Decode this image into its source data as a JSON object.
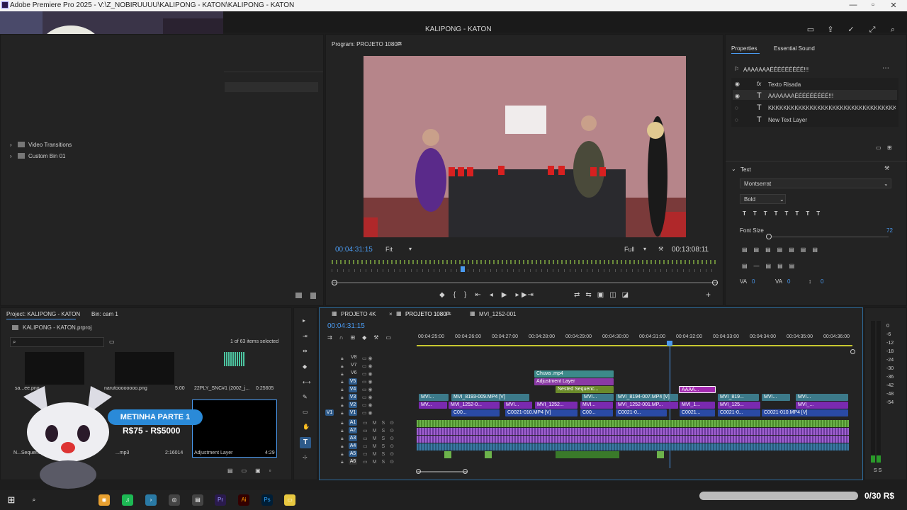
{
  "window": {
    "title": "Adobe Premiere Pro 2025 - V:\\Z_NOBIRUUUU\\KALIPONG - KATON\\KALIPONG - KATON",
    "project_name": "KALIPONG - KATON"
  },
  "project_tree": {
    "items": [
      "Video Transitions",
      "Custom Bin 01"
    ]
  },
  "program_monitor": {
    "title": "Program: PROJETO 1080P",
    "timecode": "00:04:31:15",
    "fit": "Fit",
    "quality": "Full",
    "duration": "00:13:08:11"
  },
  "properties": {
    "tabs": [
      "Properties",
      "Essential Sound"
    ],
    "selected_layer": "AAAAAAAÉÉÉÉÉÉÉÉÉ!!!",
    "layers": [
      {
        "name": "Texto Risada",
        "icon": "fx-icon"
      },
      {
        "name": "AAAAAAAÉÉÉÉÉÉÉÉÉ!!!",
        "icon": "text-icon"
      },
      {
        "name": "KKKKKKKKKKKKKKKKKKKKKKKKKKKKKKKKKKKKKKKKK...",
        "icon": "text-icon"
      },
      {
        "name": "New Text Layer",
        "icon": "text-icon"
      }
    ],
    "text_section": "Text",
    "font": "Montserrat",
    "weight": "Bold",
    "font_size_label": "Font Size",
    "font_size": "72",
    "val_a": "0",
    "val_b": "0",
    "val_c": "0"
  },
  "project_panel": {
    "title": "Project: KALIPONG - KATON",
    "bin_tab": "Bin: cam 1",
    "file": "KALIPONG - KATON.prproj",
    "selection": "1 of 63 items selected",
    "items": [
      {
        "name": "sa...ee.png",
        "dur": ""
      },
      {
        "name": "narutoooooooo.png",
        "dur": "5:00"
      },
      {
        "name": "22PLY_SNC#1 (2002_j...",
        "dur": "0:25605"
      },
      {
        "name": "N...Sequence",
        "dur": ""
      },
      {
        "name": "...mp3",
        "dur": "2:16014"
      },
      {
        "name": "Adjustment Layer",
        "dur": "4:29"
      }
    ]
  },
  "overlay": {
    "badge": "METINHA PARTE 1",
    "price": "R$75 - R$5000",
    "goal": "0/30 R$"
  },
  "timeline": {
    "tabs": [
      "PROJETO 4K",
      "PROJETO 1080P",
      "MVI_1252-001"
    ],
    "timecode": "00:04:31:15",
    "ruler": [
      "00:04:25:00",
      "00:04:26:00",
      "00:04:27:00",
      "00:04:28:00",
      "00:04:29:00",
      "00:04:30:00",
      "00:04:31:00",
      "00:04:32:00",
      "00:04:33:00",
      "00:04:34:00",
      "00:04:35:00",
      "00:04:36:00"
    ],
    "video_tracks": [
      "V8",
      "V7",
      "V6",
      "V5",
      "V4",
      "V3",
      "V2",
      "V1"
    ],
    "audio_tracks": [
      "A1",
      "A2",
      "A3",
      "A4",
      "A5",
      "A6"
    ],
    "clips": {
      "chuva": "Chuva .mp4",
      "adj": "Adjustment Layer",
      "nested": "Nested Sequenc...",
      "aaaa": "AAAA...",
      "v3a": "MVI...",
      "v3b": "MVI_8193-009.MP4 [V]",
      "v3c": "MVI...",
      "v3d": "MVI_8194-007.MP4 [V]",
      "v3e": "MVI_819...",
      "v3f": "MVI...",
      "v3g": "MVI...",
      "v2a": "MV...",
      "v2b": "MVI_1252-0...",
      "v2c": "MVI...",
      "v2d": "MVI_1252...",
      "v2e": "MVI...",
      "v2f": "MVI_1252-001.MP...",
      "v2g": "MVI_1...",
      "v2h": "MVI_125...",
      "v2i": "MVI_...",
      "v1a": "C00...",
      "v1b": "C0021-010.MP4 [V]",
      "v1c": "C00...",
      "v1d": "C0021-0...",
      "v1e": "C0021...",
      "v1f": "C0021-0...",
      "v1g": "C0021-010.MP4 [V]"
    },
    "meter_ticks": [
      "0",
      "-6",
      "-12",
      "-18",
      "-24",
      "-30",
      "-36",
      "-42",
      "-48",
      "-54"
    ],
    "meter_bottom": "S S"
  },
  "colors": {
    "accent": "#2d8ceb",
    "clip_teal": "#3c8a8a",
    "clip_purple": "#8a3aa5",
    "clip_green": "#5a8a3a",
    "audio_green": "#6db34b"
  }
}
